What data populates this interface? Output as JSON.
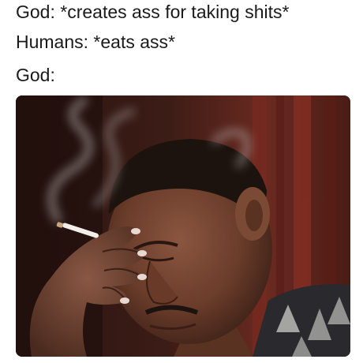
{
  "caption": {
    "line1": "God: *creates ass for taking shits*",
    "line2": "Humans: *eats ass*",
    "line3": "God:"
  },
  "photo": {
    "subject": "man-smoking-facepalm",
    "colors": {
      "background_dark": "#2a1512",
      "curtain_red": "#7a2a20",
      "skin_dark": "#5a3424",
      "skin_mid": "#7a4a34",
      "hair": "#1c120e",
      "smoke": "#b8b4b2",
      "cigarette": "#f2efe9"
    }
  }
}
